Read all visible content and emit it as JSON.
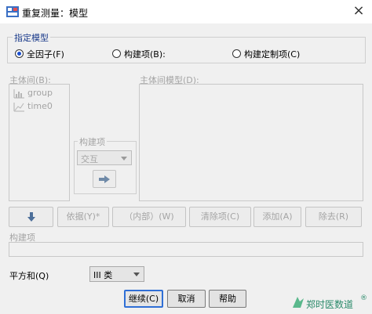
{
  "window": {
    "title": "重复测量：模型"
  },
  "model_group": {
    "label": "指定模型",
    "options": [
      {
        "label": "全因子(F)",
        "selected": true
      },
      {
        "label": "构建项(B):",
        "selected": false
      },
      {
        "label": "构建定制项(C)",
        "selected": false
      }
    ]
  },
  "subjects_panel": {
    "label": "主体间(B):",
    "items": [
      {
        "name": "group",
        "icon": "bar-chart-icon"
      },
      {
        "name": "time0",
        "icon": "line-chart-icon"
      }
    ]
  },
  "model_panel": {
    "label": "主体间模型(D):"
  },
  "build_terms": {
    "label": "构建项",
    "type_value": "交互",
    "arrow_icon": "right-arrow-icon"
  },
  "toolbar": {
    "down_icon": "down-arrow-icon",
    "buttons": [
      "依据(Y)*",
      "（内部）(W)",
      "清除项(C)",
      "添加(A)",
      "除去(R)"
    ]
  },
  "terms_label": "构建项",
  "sum_of_squares": {
    "label": "平方和(Q)",
    "value": "III 类"
  },
  "footer": {
    "continue": "继续(C)",
    "cancel": "取消",
    "help": "帮助"
  },
  "watermark": {
    "text": "郑时医数道",
    "mark": "®"
  },
  "colors": {
    "accent": "#2f6fd6",
    "radio_selected": "#1a4fd0",
    "disabled_text": "#a4a4a4"
  }
}
